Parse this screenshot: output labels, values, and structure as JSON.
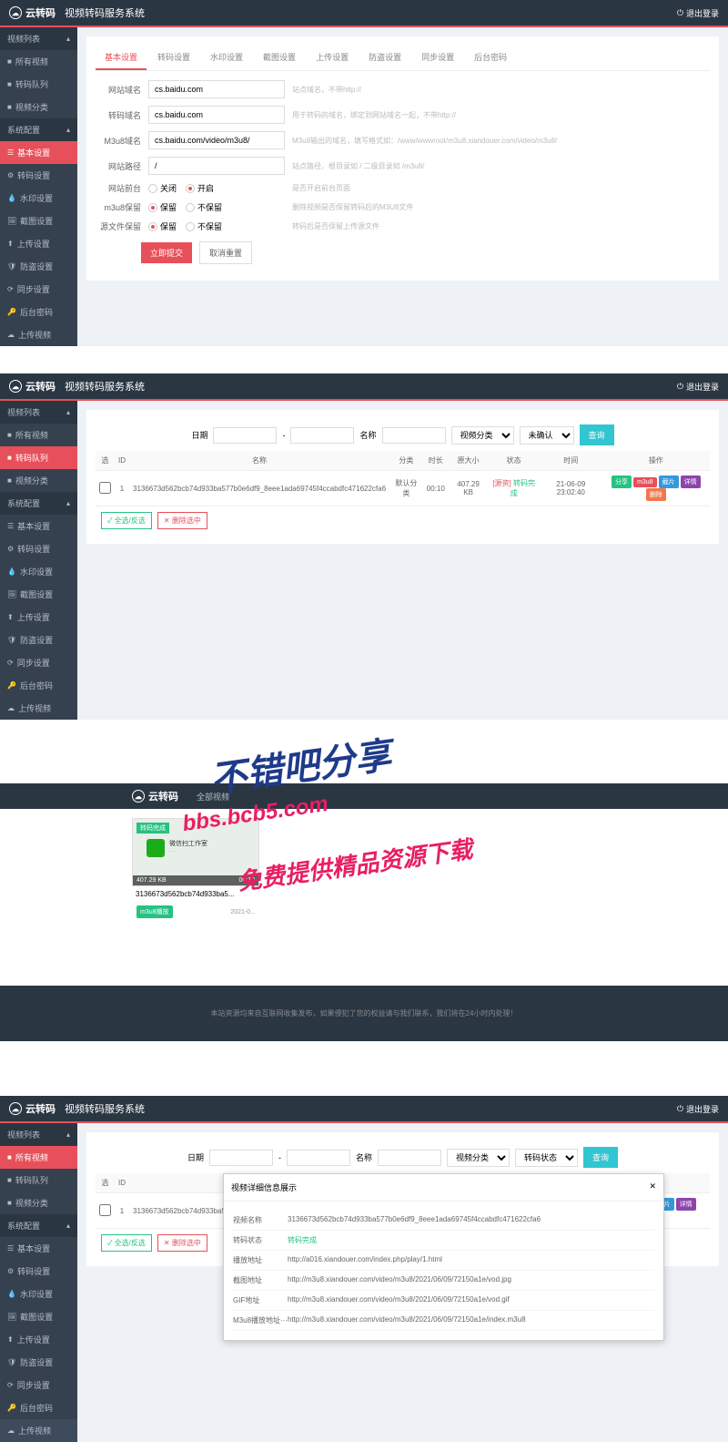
{
  "header": {
    "brand": "云转码",
    "title": "视频转码服务系统",
    "logout": "退出登录"
  },
  "sidebar": {
    "groups": [
      {
        "label": "视频列表",
        "items": [
          {
            "label": "所有视频",
            "icon": "■"
          },
          {
            "label": "转码队列",
            "icon": "■"
          },
          {
            "label": "视频分类",
            "icon": "■"
          }
        ]
      },
      {
        "label": "系统配置",
        "items": [
          {
            "label": "基本设置",
            "icon": "☰"
          },
          {
            "label": "转码设置",
            "icon": "⚙"
          },
          {
            "label": "水印设置",
            "icon": "💧"
          },
          {
            "label": "截图设置",
            "icon": "🖼"
          },
          {
            "label": "上传设置",
            "icon": "⬆"
          },
          {
            "label": "防盗设置",
            "icon": "🛡"
          },
          {
            "label": "同步设置",
            "icon": "⟳"
          },
          {
            "label": "后台密码",
            "icon": "🔑"
          },
          {
            "label": "上传视频",
            "icon": "☁"
          }
        ]
      }
    ]
  },
  "panel1": {
    "tabs": [
      "基本设置",
      "转码设置",
      "水印设置",
      "截图设置",
      "上传设置",
      "防盗设置",
      "同步设置",
      "后台密码"
    ],
    "fields": [
      {
        "label": "网站域名",
        "value": "cs.baidu.com",
        "hint": "站点域名，不带http://"
      },
      {
        "label": "转码域名",
        "value": "cs.baidu.com",
        "hint": "用于转码的域名，绑定到网站域名一起，不带http://"
      },
      {
        "label": "M3u8域名",
        "value": "cs.baidu.com/video/m3u8/",
        "hint": "M3u8输出的域名，填写格式如：/www/wwwroot/m3u8.xiandouer.com/video/m3u8/"
      },
      {
        "label": "网站路径",
        "value": "/",
        "hint": "站点路径，根目录如 / 二级目录如 /m3u8/"
      }
    ],
    "radios": [
      {
        "label": "网站前台",
        "opt1": "关闭",
        "opt2": "开启",
        "checked": 2,
        "hint": "是否开启前台页面"
      },
      {
        "label": "m3u8保留",
        "opt1": "保留",
        "opt2": "不保留",
        "checked": 1,
        "hint": "删除视频是否保留转码后的M3U8文件"
      },
      {
        "label": "源文件保留",
        "opt1": "保留",
        "opt2": "不保留",
        "checked": 1,
        "hint": "转码后是否保留上传源文件"
      }
    ],
    "buttons": {
      "save": "立即提交",
      "reset": "取消重置"
    }
  },
  "panel2": {
    "filter": {
      "date": "日期",
      "sep": "-",
      "name": "名称",
      "cat": "视频分类",
      "status": "未确认",
      "query": "查询"
    },
    "headers": [
      "选",
      "ID",
      "名称",
      "分类",
      "时长",
      "原大小",
      "状态",
      "时间",
      "操作"
    ],
    "row": {
      "id": "1",
      "name": "3136673d562bcb74d933ba577b0e6df9_8eee1ada69745f4ccabdfc471622cfa6",
      "cat": "默认分类",
      "dur": "00:10",
      "size": "407.29 KB",
      "status_pre": "[源资]",
      "status": "转码完成",
      "time": "21-06-09 23:02:40"
    },
    "actions": {
      "ops": [
        "分享",
        "m3u8",
        "截片",
        "详情",
        "删除"
      ]
    },
    "footer": {
      "all": "全选/反选",
      "del": "删除选中"
    }
  },
  "panel3": {
    "nav": "全部视频",
    "card": {
      "badge": "转码完成",
      "size": "407.29 KB",
      "dur": "00:10",
      "title": "3136673d562bcb74d933ba5...",
      "btn": "m3u8播放",
      "date": "2021-0..."
    },
    "footer": "本站资源均来自互联网收集发布，如果侵犯了您的权益请与我们联系，我们将在24小时内处理！"
  },
  "panel4": {
    "filter": {
      "status": "转码状态"
    },
    "modal": {
      "title": "视频详细信息展示",
      "rows": [
        {
          "label": "视频名称",
          "value": "3136673d562bcb74d933ba577b0e6df9_8eee1ada69745f4ccabdfc471622cfa6"
        },
        {
          "label": "转码状态",
          "value": "转码完成",
          "green": true
        },
        {
          "label": "播放地址",
          "value": "http://a016.xiandouer.com/index.php/play/1.html"
        },
        {
          "label": "截图地址",
          "value": "http://m3u8.xiandouer.com/video/m3u8/2021/06/09/72150a1e/vod.jpg"
        },
        {
          "label": "GIF地址",
          "value": "http://m3u8.xiandouer.com/video/m3u8/2021/06/09/72150a1e/vod.gif"
        },
        {
          "label": "M3u8播放地址···",
          "value": "http://m3u8.xiandouer.com/video/m3u8/2021/06/09/72150a1e/index.m3u8"
        }
      ]
    }
  },
  "watermark": {
    "line1": "不错吧分享",
    "line2": "bbs.bcb5.com",
    "line3": "免费提供精品资源下载"
  }
}
